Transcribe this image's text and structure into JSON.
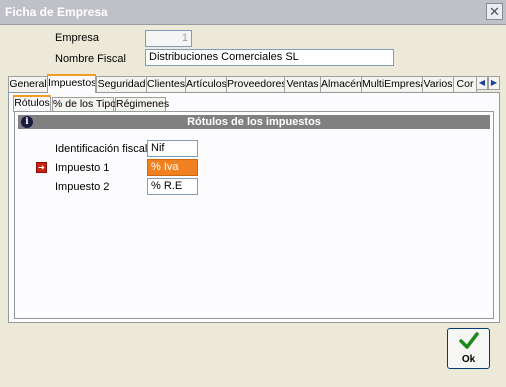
{
  "window": {
    "title": "Ficha de Empresa",
    "close_glyph": "✕"
  },
  "header": {
    "empresa_label": "Empresa",
    "empresa_value": "1",
    "nombre_label": "Nombre Fiscal",
    "nombre_value": "Distribuciones Comerciales SL"
  },
  "tabs": [
    {
      "label": "General"
    },
    {
      "label": "Impuestos",
      "selected": true
    },
    {
      "label": "Seguridad"
    },
    {
      "label": "Clientes"
    },
    {
      "label": "Artículos"
    },
    {
      "label": "Proveedores"
    },
    {
      "label": "Ventas"
    },
    {
      "label": "Almacén"
    },
    {
      "label": "MultiEmpresa"
    },
    {
      "label": "Varios"
    },
    {
      "label": "Cor"
    }
  ],
  "tab_scroll": {
    "left": "◀",
    "right": "▶"
  },
  "subtabs": [
    {
      "label": "Rótulos",
      "selected": true
    },
    {
      "label": "% de los Tipos"
    },
    {
      "label": "Régimenes"
    }
  ],
  "section": {
    "info_glyph": "i",
    "title": "Rótulos de los impuestos"
  },
  "form": {
    "ident_label": "Identificación fiscal",
    "ident_value": "Nif",
    "imp1_label": "Impuesto 1",
    "imp1_value": "% Iva",
    "imp2_label": "Impuesto 2",
    "imp2_value": "% R.E",
    "pointer_glyph": "➜"
  },
  "ok_button": {
    "label": "Ok"
  },
  "colors": {
    "accent_tab": "#f0a020",
    "active_field": "#f08020",
    "ok_check": "#1a8a1a"
  }
}
